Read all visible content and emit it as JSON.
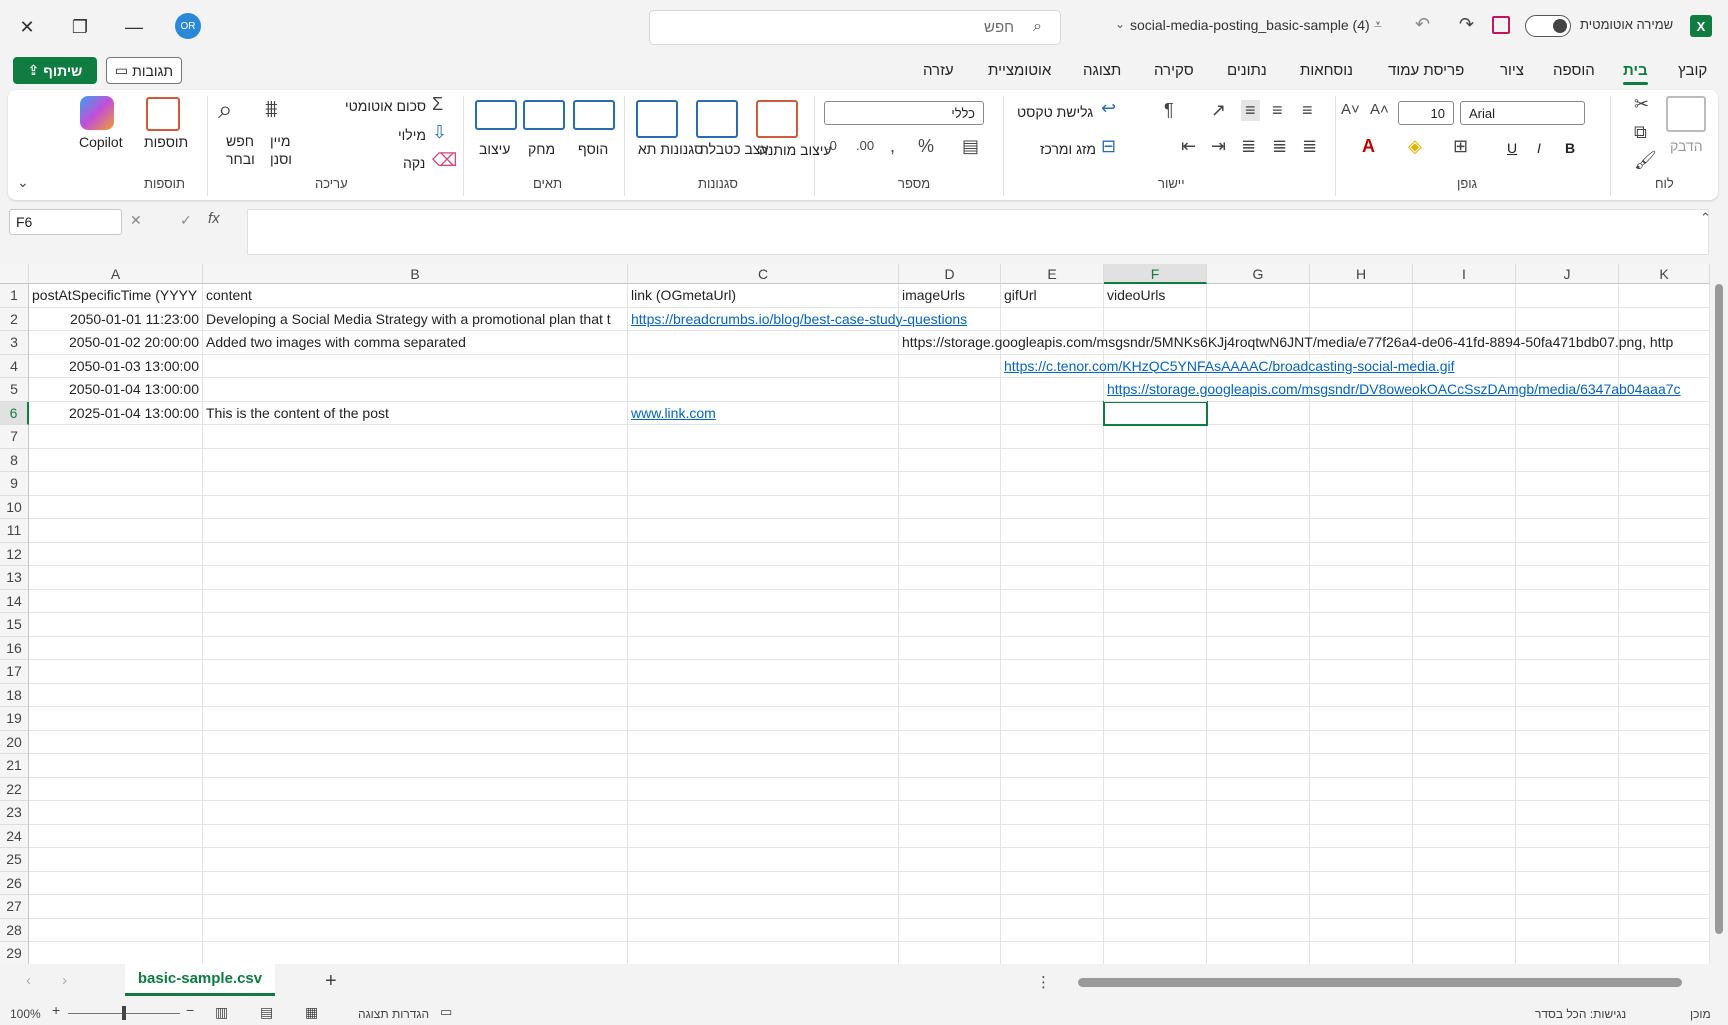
{
  "window": {
    "title": "social-media-posting_basic-sample (4)",
    "autosave_label": "שמירה אוטומטית",
    "avatar_initials": "OR",
    "search_placeholder": "חפש"
  },
  "tabs": [
    "קובץ",
    "בית",
    "הוספה",
    "ציור",
    "פריסת עמוד",
    "נוסחאות",
    "נתונים",
    "סקירה",
    "תצוגה",
    "אוטומציית",
    "עזרה"
  ],
  "actions": {
    "share": "שיתוף",
    "comments": "תגובות"
  },
  "ribbon": {
    "groups": {
      "clipboard": "לוח",
      "font": "גופן",
      "alignment": "יישור",
      "number": "מספר",
      "styles": "סגנונות",
      "cells": "תאים",
      "editing": "עריכה",
      "addins": "תוספות"
    },
    "paste": "הדבק",
    "font_name": "Arial",
    "font_size": "10",
    "wrap_text": "גלישת טקסט",
    "merge_center": "מזג ומרכז",
    "number_format": "כללי",
    "conditional_formatting": "עיצוב מותנה",
    "format_as_table": "עצב כטבלה",
    "cell_styles": "סגנונות תא",
    "insert": "הוסף",
    "delete": "מחק",
    "format": "עיצוב",
    "autosum": "סכום אוטומטי",
    "fill": "מילוי",
    "clear": "נקה",
    "sort_filter": "מיין וסנן",
    "find_select": "חפש ובחר",
    "addins": "תוספות",
    "copilot": "Copilot",
    "bold": "B",
    "italic": "I",
    "underline": "U"
  },
  "formula_bar": {
    "name_box": "F6",
    "fx": "fx"
  },
  "columns": [
    "A",
    "B",
    "C",
    "D",
    "E",
    "F",
    "G",
    "H",
    "I",
    "J",
    "K"
  ],
  "rows_count": 29,
  "cells": {
    "A1": "postAtSpecificTime (YYYY",
    "B1": "content",
    "C1": "link (OGmetaUrl)",
    "D1": "imageUrls",
    "E1": "gifUrl",
    "F1": "videoUrls",
    "A2": "2050-01-01 11:23:00",
    "B2": "Developing a Social Media Strategy with a promotional plan that t",
    "C2": "https://breadcrumbs.io/blog/best-case-study-questions",
    "A3": "2050-01-02 20:00:00",
    "B3": "Added two images with comma separated",
    "D3": "https://storage.googleapis.com/msgsndr/5MNKs6KJj4roqtwN6JNT/media/e77f26a4-de06-41fd-8894-50fa471bdb07.png, http",
    "A4": "2050-01-03 13:00:00",
    "E4": "https://c.tenor.com/KHzQC5YNFAsAAAAC/broadcasting-social-media.gif",
    "A5": "2050-01-04 13:00:00",
    "F5": "https://storage.googleapis.com/msgsndr/DV8oweokOACcSszDAmgb/media/6347ab04aaa7c",
    "A6": "2025-01-04 13:00:00",
    "B6": "This is the content of the post",
    "C6": "www.link.com"
  },
  "sheet_tab": "basic-sample.csv",
  "status": {
    "ready": "מוכן",
    "accessibility": "נגישות: הכל בסדר",
    "display_settings": "הגדרות תצוגה",
    "zoom": "100%"
  },
  "colors": {
    "accent": "#107c41",
    "link": "#0563c1"
  }
}
